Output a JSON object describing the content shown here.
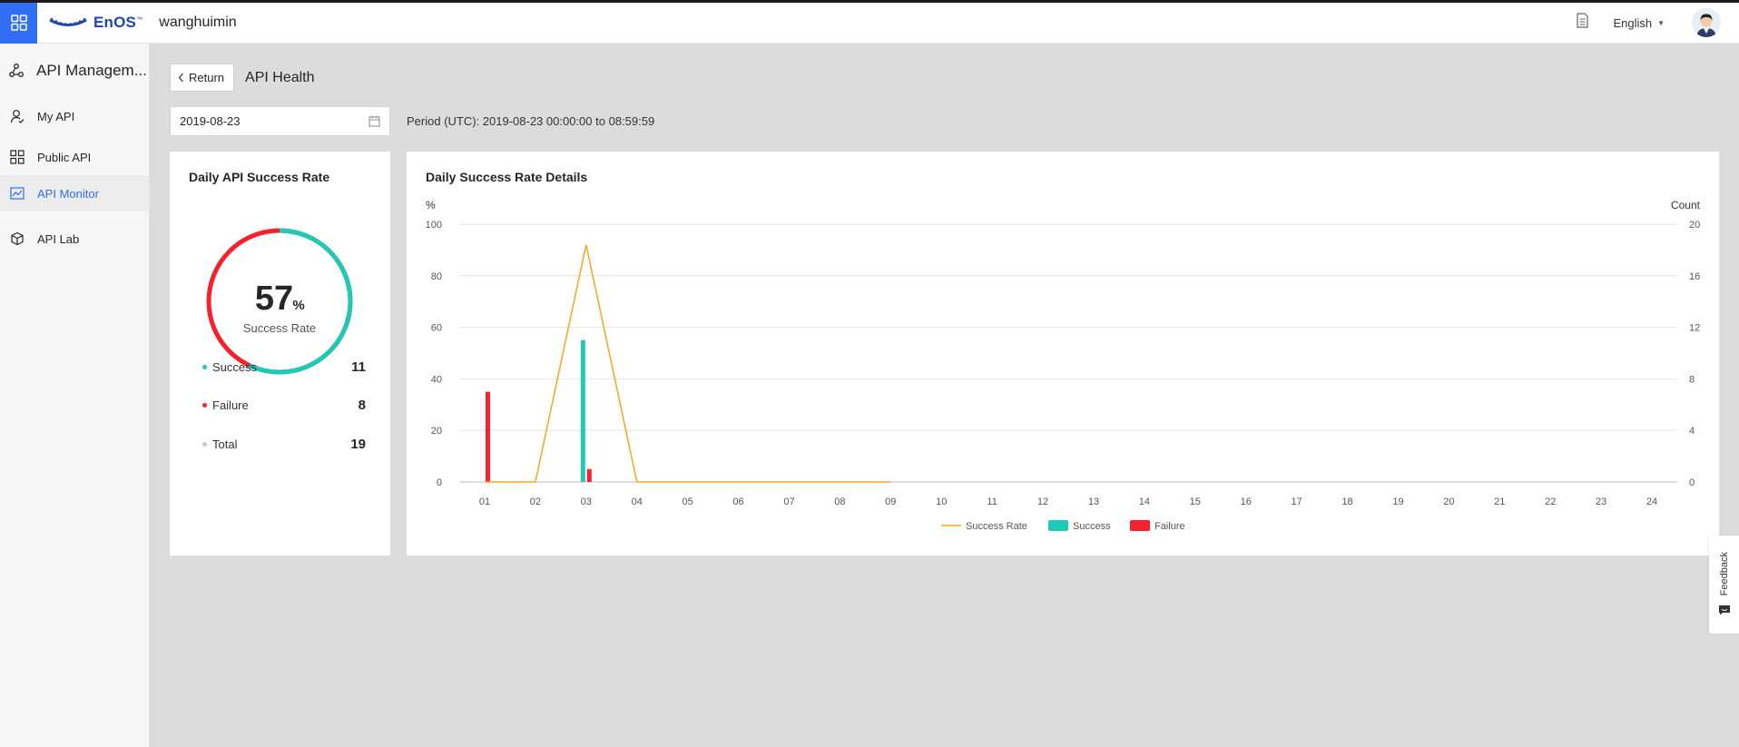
{
  "header": {
    "logo_text": "EnOS",
    "logo_tm": "™",
    "org_name": "wanghuimin",
    "language": "English",
    "icons": {
      "app_switcher": "grid-icon",
      "docs": "document-icon",
      "avatar": "user-avatar"
    },
    "accent": "#2f6ef5"
  },
  "sidebar": {
    "title": "API Managem...",
    "items": [
      {
        "label": "My API",
        "icon": "user-icon",
        "active": false
      },
      {
        "label": "Public API",
        "icon": "grid-icon",
        "active": false
      },
      {
        "label": "API Monitor",
        "icon": "chart-icon",
        "active": true
      },
      {
        "label": "API Lab",
        "icon": "cube-icon",
        "active": false
      }
    ]
  },
  "page": {
    "return_label": "Return",
    "title": "API Health",
    "date_value": "2019-08-23",
    "period_text": "Period (UTC): 2019-08-23 00:00:00 to 08:59:59"
  },
  "summary": {
    "title": "Daily API Success Rate",
    "rate_value": "57",
    "rate_unit": "%",
    "rate_label": "Success Rate",
    "rate_fraction": 0.57,
    "stats": [
      {
        "label": "Success",
        "value": "11",
        "color": "#1dc9b7"
      },
      {
        "label": "Failure",
        "value": "8",
        "color": "#f5222d"
      },
      {
        "label": "Total",
        "value": "19",
        "color": "#c8c8c8"
      }
    ]
  },
  "details": {
    "title": "Daily Success Rate Details"
  },
  "chart_data": {
    "type": "bar",
    "categories": [
      "01",
      "02",
      "03",
      "04",
      "05",
      "06",
      "07",
      "08",
      "09",
      "10",
      "11",
      "12",
      "13",
      "14",
      "15",
      "16",
      "17",
      "18",
      "19",
      "20",
      "21",
      "22",
      "23",
      "24"
    ],
    "left_axis": {
      "label": "%",
      "range": [
        0,
        100
      ],
      "ticks": [
        "0",
        "20",
        "40",
        "60",
        "80",
        "100"
      ]
    },
    "right_axis": {
      "label": "Count",
      "range": [
        0,
        20
      ],
      "ticks": [
        "0",
        "4",
        "8",
        "12",
        "16",
        "20"
      ]
    },
    "series": [
      {
        "name": "Success Rate",
        "type": "line",
        "axis": "left",
        "color": "#f5a623",
        "values": [
          0,
          0,
          92,
          0,
          0,
          0,
          0,
          0,
          0
        ]
      },
      {
        "name": "Success",
        "type": "bar",
        "axis": "right",
        "color": "#1dc9b7",
        "values": [
          0,
          0,
          11,
          0,
          0,
          0,
          0,
          0,
          0
        ]
      },
      {
        "name": "Failure",
        "type": "bar",
        "axis": "right",
        "color": "#f5222d",
        "values": [
          7,
          0,
          1,
          0,
          0,
          0,
          0,
          0,
          0
        ]
      }
    ],
    "grid": true,
    "legend_position": "bottom-center"
  },
  "feedback_label": "Feedback"
}
